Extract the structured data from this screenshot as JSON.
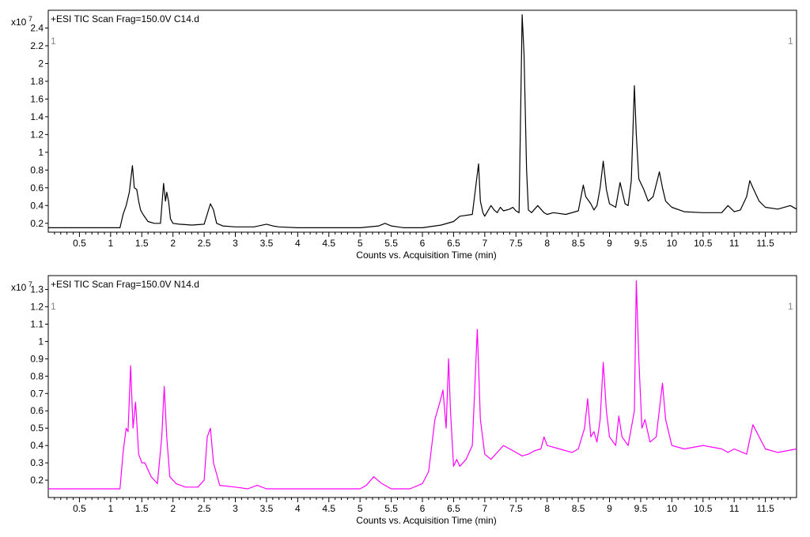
{
  "chart_data": [
    {
      "type": "line",
      "title": "+ESI TIC Scan Frag=150.0V C14.d",
      "multiplier_label": "x10",
      "multiplier_exponent": "7",
      "corner_label_left": "1",
      "corner_label_right": "1",
      "xlabel": "Counts vs. Acquisition Time (min)",
      "ylabel": "",
      "xlim": [
        0,
        12.0
      ],
      "ylim": [
        0.1,
        2.6
      ],
      "grid": false,
      "xticks": [
        0.5,
        1,
        1.5,
        2,
        2.5,
        3,
        3.5,
        4,
        4.5,
        5,
        5.5,
        6,
        6.5,
        7,
        7.5,
        8,
        8.5,
        9,
        9.5,
        10,
        10.5,
        11,
        11.5
      ],
      "xtick_labels": [
        "0.5",
        "1",
        "1.5",
        "2",
        "2.5",
        "3",
        "3.5",
        "4",
        "4.5",
        "5",
        "5.5",
        "6",
        "6.5",
        "7",
        "7.5",
        "8",
        "8.5",
        "9",
        "9.5",
        "10",
        "10.5",
        "11",
        "11.5"
      ],
      "yticks": [
        0.2,
        0.4,
        0.6,
        0.8,
        1,
        1.2,
        1.4,
        1.6,
        1.8,
        2,
        2.2,
        2.4
      ],
      "ytick_labels": [
        "0.2",
        "0.4",
        "0.6",
        "0.8",
        "1",
        "1.2",
        "1.4",
        "1.6",
        "1.8",
        "2",
        "2.2",
        "2.4"
      ],
      "series": [
        {
          "color": "#000000",
          "x": [
            0,
            1.15,
            1.2,
            1.25,
            1.3,
            1.35,
            1.38,
            1.42,
            1.45,
            1.48,
            1.52,
            1.6,
            1.7,
            1.8,
            1.85,
            1.88,
            1.9,
            1.93,
            1.96,
            2.0,
            2.1,
            2.3,
            2.5,
            2.6,
            2.65,
            2.7,
            2.8,
            3.0,
            3.3,
            3.5,
            3.6,
            3.7,
            4.0,
            4.5,
            5.0,
            5.3,
            5.4,
            5.5,
            5.7,
            6.0,
            6.3,
            6.5,
            6.6,
            6.8,
            6.9,
            6.93,
            6.97,
            7.0,
            7.1,
            7.15,
            7.2,
            7.25,
            7.3,
            7.4,
            7.45,
            7.5,
            7.55,
            7.6,
            7.63,
            7.67,
            7.7,
            7.75,
            7.85,
            7.95,
            8.0,
            8.1,
            8.3,
            8.5,
            8.58,
            8.62,
            8.7,
            8.75,
            8.8,
            8.85,
            8.9,
            8.95,
            9.0,
            9.1,
            9.17,
            9.25,
            9.3,
            9.35,
            9.4,
            9.43,
            9.47,
            9.55,
            9.62,
            9.7,
            9.8,
            9.85,
            9.9,
            10.0,
            10.2,
            10.5,
            10.8,
            10.9,
            11.0,
            11.1,
            11.2,
            11.25,
            11.3,
            11.4,
            11.5,
            11.7,
            11.9,
            12.0
          ],
          "y": [
            0.15,
            0.15,
            0.3,
            0.4,
            0.55,
            0.85,
            0.6,
            0.58,
            0.45,
            0.35,
            0.3,
            0.22,
            0.2,
            0.2,
            0.65,
            0.45,
            0.55,
            0.45,
            0.25,
            0.2,
            0.19,
            0.18,
            0.19,
            0.42,
            0.35,
            0.2,
            0.17,
            0.16,
            0.16,
            0.19,
            0.17,
            0.16,
            0.15,
            0.15,
            0.15,
            0.17,
            0.2,
            0.17,
            0.15,
            0.15,
            0.18,
            0.22,
            0.28,
            0.3,
            0.87,
            0.45,
            0.32,
            0.28,
            0.4,
            0.35,
            0.32,
            0.38,
            0.34,
            0.36,
            0.38,
            0.34,
            0.32,
            2.55,
            2.1,
            0.8,
            0.35,
            0.32,
            0.4,
            0.32,
            0.3,
            0.32,
            0.3,
            0.34,
            0.63,
            0.5,
            0.42,
            0.35,
            0.4,
            0.6,
            0.9,
            0.58,
            0.42,
            0.38,
            0.66,
            0.42,
            0.4,
            0.68,
            1.75,
            1.2,
            0.7,
            0.58,
            0.45,
            0.5,
            0.78,
            0.6,
            0.45,
            0.38,
            0.33,
            0.32,
            0.32,
            0.4,
            0.33,
            0.35,
            0.5,
            0.68,
            0.6,
            0.45,
            0.38,
            0.36,
            0.4,
            0.36
          ]
        }
      ]
    },
    {
      "type": "line",
      "title": "+ESI TIC Scan Frag=150.0V N14.d",
      "multiplier_label": "x10",
      "multiplier_exponent": "7",
      "corner_label_left": "1",
      "corner_label_right": "1",
      "xlabel": "Counts vs. Acquisition Time (min)",
      "ylabel": "",
      "xlim": [
        0,
        12.0
      ],
      "ylim": [
        0.1,
        1.38
      ],
      "grid": false,
      "xticks": [
        0.5,
        1,
        1.5,
        2,
        2.5,
        3,
        3.5,
        4,
        4.5,
        5,
        5.5,
        6,
        6.5,
        7,
        7.5,
        8,
        8.5,
        9,
        9.5,
        10,
        10.5,
        11,
        11.5
      ],
      "xtick_labels": [
        "0.5",
        "1",
        "1.5",
        "2",
        "2.5",
        "3",
        "3.5",
        "4",
        "4.5",
        "5",
        "5.5",
        "6",
        "6.5",
        "7",
        "7.5",
        "8",
        "8.5",
        "9",
        "9.5",
        "10",
        "10.5",
        "11",
        "11.5"
      ],
      "yticks": [
        0.2,
        0.3,
        0.4,
        0.5,
        0.6,
        0.7,
        0.8,
        0.9,
        1,
        1.1,
        1.2,
        1.3
      ],
      "ytick_labels": [
        "0.2",
        "0.3",
        "0.4",
        "0.5",
        "0.6",
        "0.7",
        "0.8",
        "0.9",
        "1",
        "1.1",
        "1.2",
        "1.3"
      ],
      "series": [
        {
          "color": "#ff00ff",
          "x": [
            0,
            1.15,
            1.2,
            1.25,
            1.28,
            1.32,
            1.36,
            1.4,
            1.45,
            1.5,
            1.55,
            1.65,
            1.75,
            1.82,
            1.86,
            1.9,
            1.95,
            2.05,
            2.2,
            2.4,
            2.5,
            2.55,
            2.6,
            2.65,
            2.75,
            3.0,
            3.2,
            3.35,
            3.5,
            4.0,
            4.5,
            5.0,
            5.1,
            5.22,
            5.35,
            5.5,
            5.8,
            6.0,
            6.1,
            6.2,
            6.28,
            6.33,
            6.38,
            6.42,
            6.45,
            6.5,
            6.55,
            6.6,
            6.7,
            6.8,
            6.88,
            6.93,
            7.0,
            7.1,
            7.2,
            7.3,
            7.4,
            7.5,
            7.6,
            7.7,
            7.8,
            7.9,
            7.95,
            8.0,
            8.2,
            8.4,
            8.5,
            8.6,
            8.65,
            8.7,
            8.75,
            8.8,
            8.85,
            8.9,
            8.95,
            9.0,
            9.1,
            9.15,
            9.2,
            9.3,
            9.4,
            9.43,
            9.47,
            9.52,
            9.57,
            9.65,
            9.75,
            9.85,
            9.9,
            10.0,
            10.2,
            10.5,
            10.8,
            10.9,
            11.0,
            11.2,
            11.3,
            11.4,
            11.5,
            11.7,
            12.0
          ],
          "y": [
            0.15,
            0.15,
            0.36,
            0.5,
            0.48,
            0.86,
            0.5,
            0.65,
            0.35,
            0.3,
            0.3,
            0.22,
            0.18,
            0.45,
            0.74,
            0.45,
            0.22,
            0.18,
            0.16,
            0.16,
            0.2,
            0.45,
            0.5,
            0.3,
            0.17,
            0.16,
            0.15,
            0.17,
            0.15,
            0.15,
            0.15,
            0.15,
            0.17,
            0.22,
            0.18,
            0.15,
            0.15,
            0.18,
            0.25,
            0.55,
            0.65,
            0.72,
            0.5,
            0.9,
            0.6,
            0.28,
            0.32,
            0.28,
            0.32,
            0.4,
            1.07,
            0.55,
            0.35,
            0.32,
            0.36,
            0.4,
            0.38,
            0.36,
            0.34,
            0.35,
            0.37,
            0.38,
            0.45,
            0.4,
            0.38,
            0.36,
            0.38,
            0.5,
            0.67,
            0.45,
            0.48,
            0.42,
            0.55,
            0.88,
            0.6,
            0.45,
            0.4,
            0.57,
            0.45,
            0.4,
            0.6,
            1.35,
            0.9,
            0.5,
            0.55,
            0.42,
            0.45,
            0.76,
            0.55,
            0.4,
            0.38,
            0.4,
            0.38,
            0.36,
            0.38,
            0.35,
            0.52,
            0.45,
            0.38,
            0.36,
            0.38
          ]
        }
      ]
    }
  ]
}
